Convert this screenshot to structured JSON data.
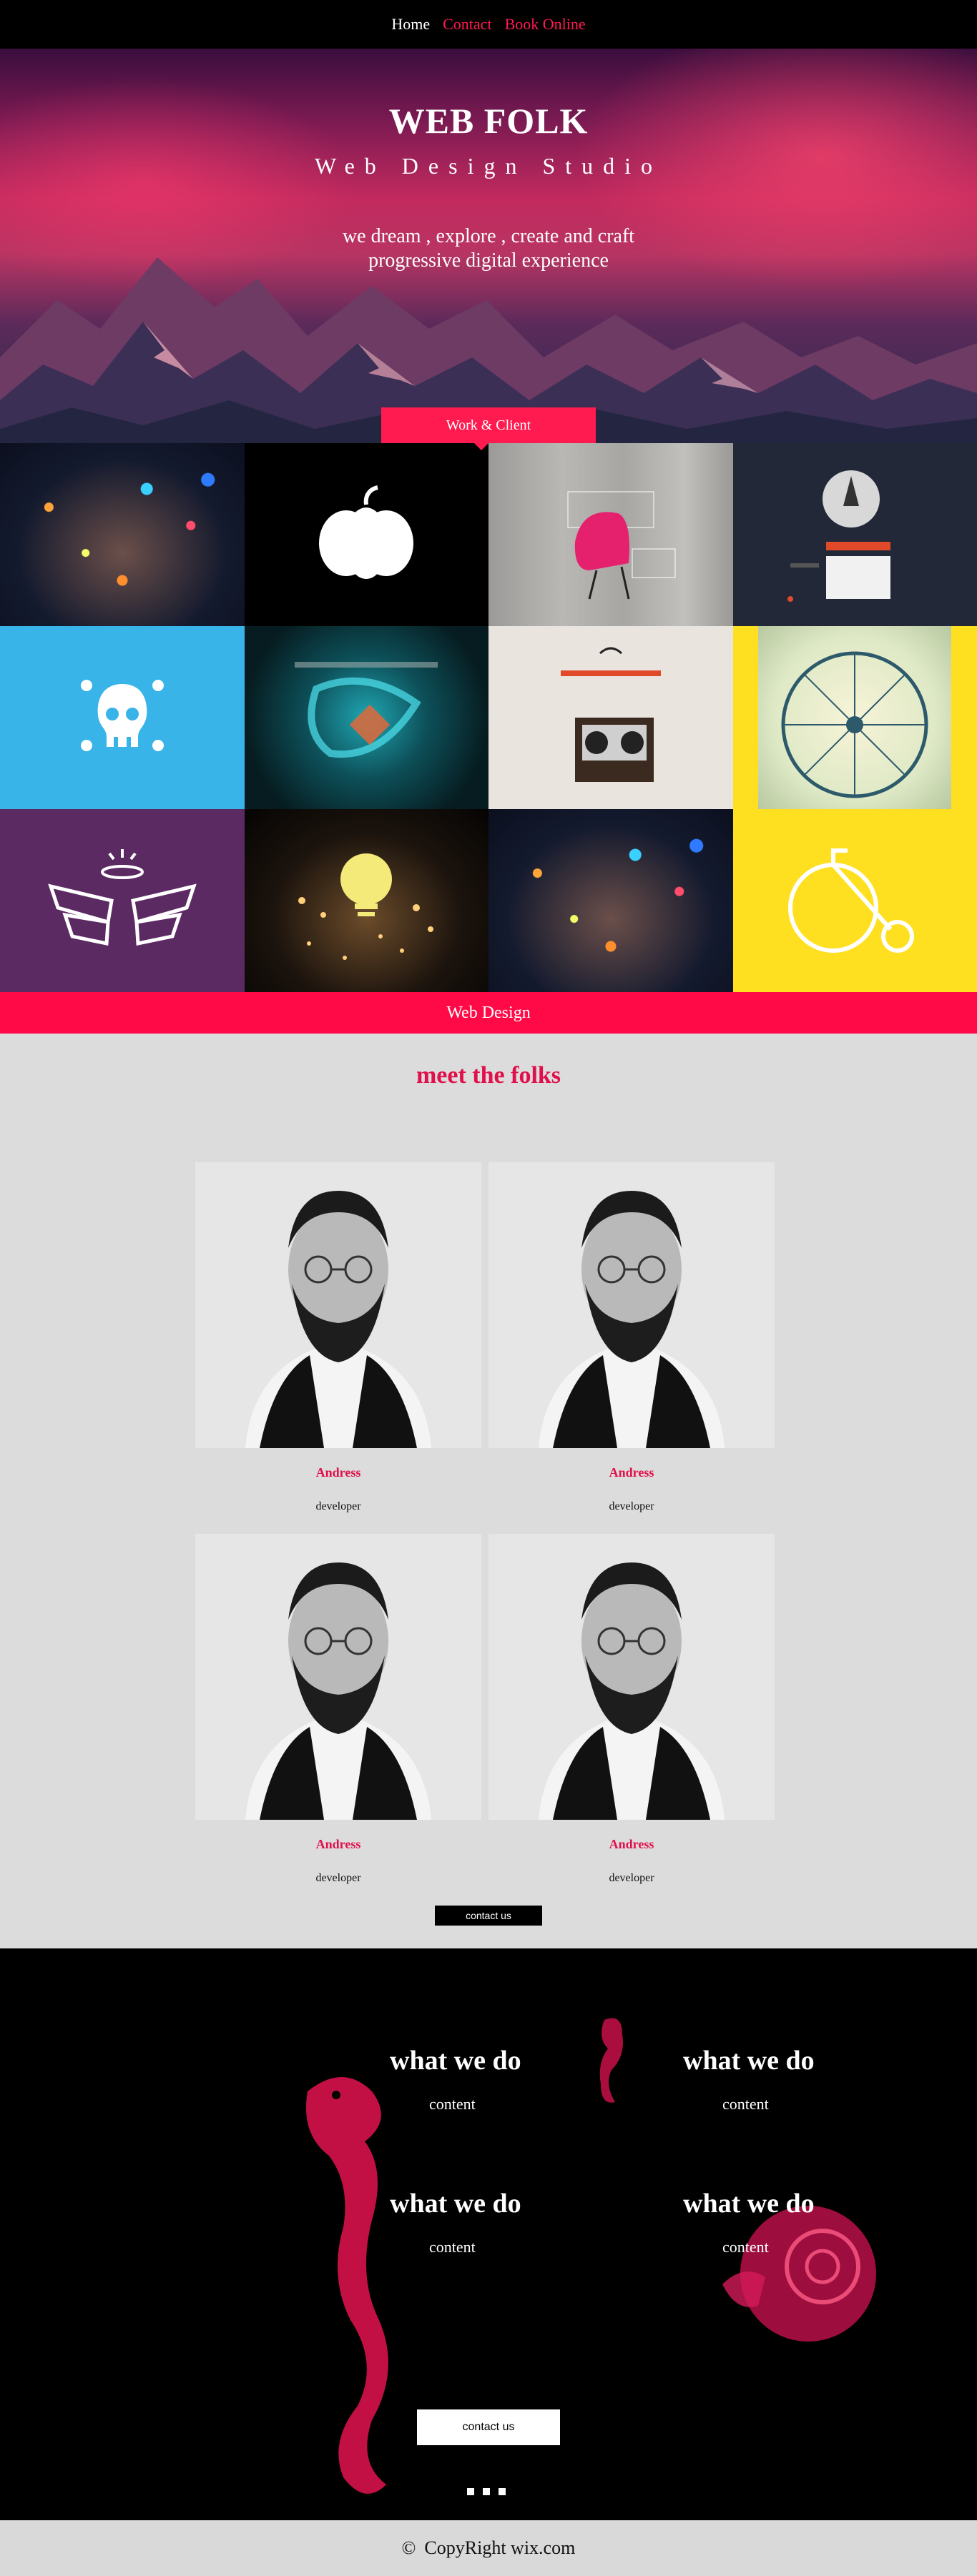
{
  "nav": {
    "home": "Home",
    "contact": "Contact",
    "book": "Book Online"
  },
  "hero": {
    "title": "WEB FOLK",
    "subtitle": "Web Design Studio",
    "tagline": "we dream , explore , create and craft progressive digital experience",
    "tab_label": "Work & Client"
  },
  "portfolio": {
    "tiles": [
      "bokeh-street",
      "pumpkin-logo",
      "pink-chair",
      "rocket-site",
      "skull-icon",
      "blue-machine",
      "tape-recorder",
      "ferris-wheel",
      "angel-wings",
      "lightbulb",
      "bokeh-street-2",
      "bicycle"
    ],
    "category_bar": "Web Design"
  },
  "folks": {
    "heading": "meet the folks",
    "members": [
      {
        "name": "Andress",
        "role": "developer"
      },
      {
        "name": "Andress",
        "role": "developer"
      },
      {
        "name": "Andress",
        "role": "developer"
      },
      {
        "name": "Andress",
        "role": "developer"
      }
    ],
    "contact_label": "contact us"
  },
  "services": {
    "items": [
      {
        "title": "what we do",
        "content": "content"
      },
      {
        "title": "what we do",
        "content": "content"
      },
      {
        "title": "what we do",
        "content": "content"
      },
      {
        "title": "what we do",
        "content": "content"
      }
    ],
    "contact_label": "contact us"
  },
  "footer": {
    "symbol": "©",
    "text": "CopyRight wix.com"
  },
  "colors": {
    "accent": "#ff1a4f",
    "folks_bg": "#dcdcdc",
    "footer_bg": "#d9d9d9"
  }
}
